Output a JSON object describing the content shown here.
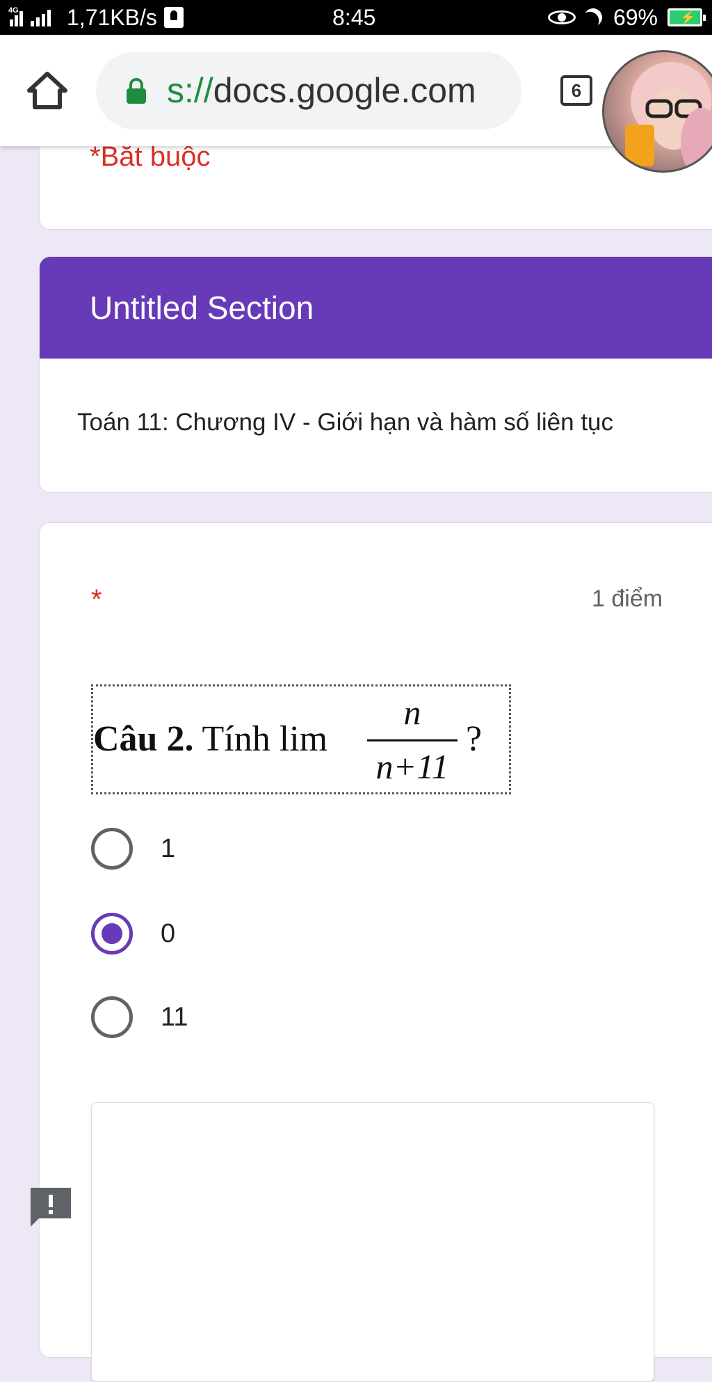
{
  "status_bar": {
    "network_type": "4G",
    "net_speed": "1,71KB/s",
    "time": "8:45",
    "battery": "69%",
    "icons": [
      "signal-icon",
      "notification-icon",
      "eye-icon",
      "moon-icon",
      "battery-charging-icon"
    ]
  },
  "browser": {
    "url_scheme_fragment": "s://",
    "url_host": "docs.google.com",
    "tab_count": "6",
    "icons": [
      "home-icon",
      "lock-icon",
      "tab-switcher-icon",
      "avatar"
    ]
  },
  "form": {
    "required_note": "*Bắt buộc",
    "section": {
      "title": "Untitled Section",
      "description": "Toán 11: Chương IV - Giới hạn và hàm số liên tục"
    },
    "question": {
      "required_star": "*",
      "points": "1 điểm",
      "image_text": {
        "label_bold": "Câu 2.",
        "label_rest": " Tính  lim",
        "numerator": "n",
        "denominator": "n+11",
        "suffix": "?"
      },
      "options": [
        {
          "label": "1",
          "selected": false
        },
        {
          "label": "0",
          "selected": true
        },
        {
          "label": "11",
          "selected": false
        }
      ]
    }
  },
  "colors": {
    "accent": "#673ab7",
    "required": "#d93025",
    "background": "#ede7f6",
    "lock": "#1e8e3e"
  }
}
